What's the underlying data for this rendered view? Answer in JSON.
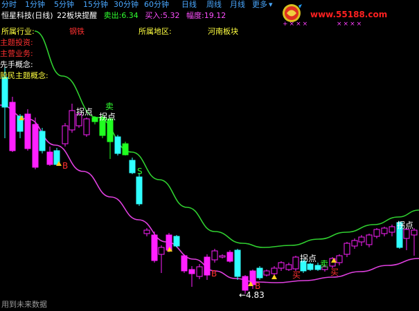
{
  "tabs": [
    {
      "label": "分时",
      "active": true
    },
    {
      "label": "1分钟"
    },
    {
      "label": "5分钟"
    },
    {
      "label": "15分钟"
    },
    {
      "label": "30分钟"
    },
    {
      "label": "60分钟"
    },
    {
      "label": "日线"
    },
    {
      "label": "周线"
    },
    {
      "label": "月线"
    },
    {
      "label": "更多"
    }
  ],
  "tab_more_arrow": "▾",
  "site": {
    "url": "www.55188.com"
  },
  "header": {
    "stock_title": "恒星科技(日线)",
    "indicator_name": "22板块提醒",
    "sell_label": "卖出:",
    "sell_value": "6.34",
    "buy_label": "买入:",
    "buy_value": "5.32",
    "amp_label": "幅度:",
    "amp_value": "19.12"
  },
  "info": {
    "industry_label": "所属行业:",
    "industry_value": "钢铁",
    "region_label": "所属地区:",
    "region_value": "河南板块",
    "theme_label": "主题投资:",
    "business_label": "主营业务:",
    "concept_label": "先手概念:",
    "popular_label": "股民主题概念:"
  },
  "annotations": {
    "guaidian": "拐点",
    "sell": "卖",
    "buy_b": "B",
    "s": "S",
    "low_price": "←4.83",
    "buy_cn": "买"
  },
  "footer": {
    "note": "用到未来数据"
  },
  "colors": {
    "up": "#ff20ff",
    "down": "#30ffff",
    "green_candle": "#20ff20",
    "ma_green": "#30d030",
    "ma_magenta": "#e040e0",
    "header_blue": "#4aa8ff",
    "label_yellow": "#ffff40",
    "label_red": "#ff3030"
  }
}
